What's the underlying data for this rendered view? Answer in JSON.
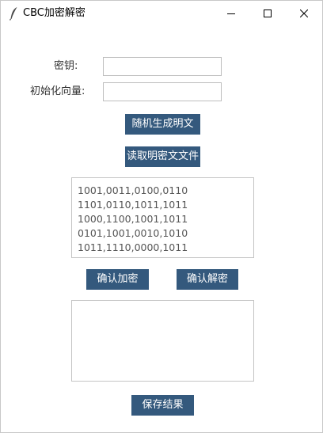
{
  "window": {
    "title": "CBC加密解密"
  },
  "form": {
    "key_label": "密钥:",
    "key_value": "",
    "iv_label": "初始化向量:",
    "iv_value": ""
  },
  "buttons": {
    "random_plaintext": "随机生成明文",
    "read_plaintext_file": "读取明密文文件",
    "encrypt": "确认加密",
    "decrypt": "确认解密",
    "save_result": "保存结果"
  },
  "input_box": {
    "lines": [
      "1001,0011,0100,0110",
      "1101,0110,1011,1011",
      "1000,1100,1001,1011",
      "0101,1001,0010,1010",
      "1011,1110,0000,1011"
    ]
  },
  "output_box": {
    "lines": []
  },
  "icons": {
    "app": "feather-icon",
    "minimize": "minimize-icon",
    "maximize": "maximize-icon",
    "close": "close-icon"
  },
  "colors": {
    "button_bg": "#34597d",
    "button_text": "#ffffff"
  }
}
